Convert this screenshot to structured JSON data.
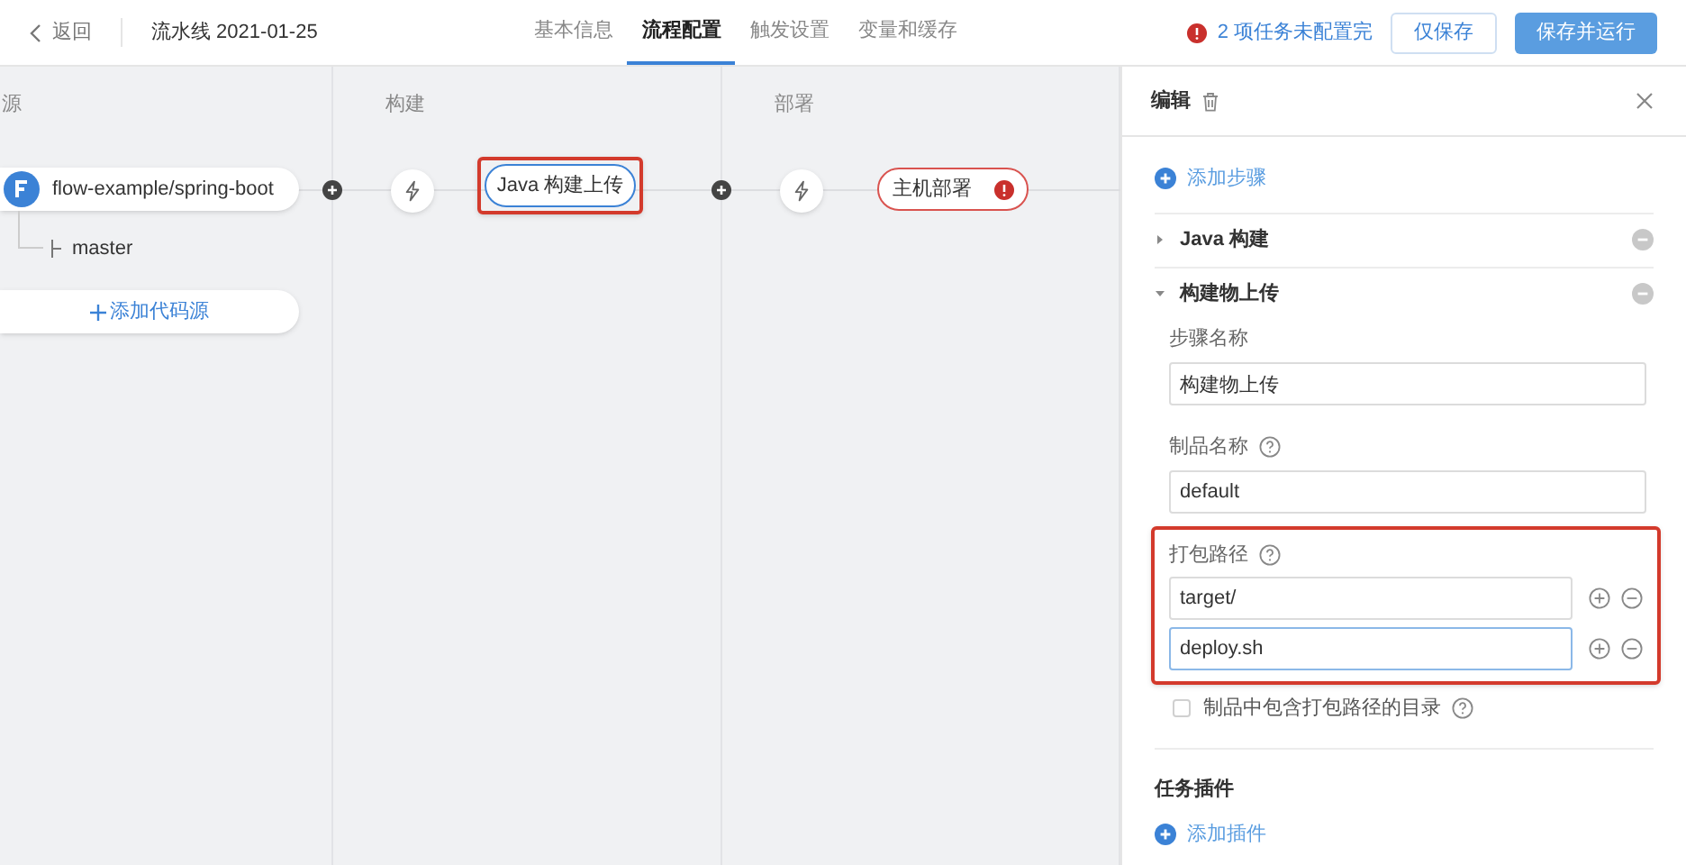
{
  "header": {
    "back": "返回",
    "title": "流水线 2021-01-25",
    "tabs": [
      {
        "label": "基本信息",
        "selected": false
      },
      {
        "label": "流程配置",
        "selected": true
      },
      {
        "label": "触发设置",
        "selected": false
      },
      {
        "label": "变量和缓存",
        "selected": false
      }
    ],
    "warning": "2 项任务未配置完",
    "buttons": [
      {
        "label": "仅保存",
        "kind": "secondary"
      },
      {
        "label": "保存并运行",
        "kind": "primary"
      }
    ]
  },
  "canvas": {
    "stages": [
      {
        "label": "源"
      },
      {
        "label": "构建"
      },
      {
        "label": "部署"
      }
    ],
    "source": {
      "repo": "flow-example/spring-boot",
      "branch": "master",
      "add_button": "添加代码源"
    },
    "tasks": [
      {
        "label": "Java 构建上传",
        "error": false,
        "highlighted": true
      },
      {
        "label": "主机部署",
        "error": true,
        "highlighted": false
      }
    ]
  },
  "panel": {
    "title": "编辑",
    "add_step": "添加步骤",
    "steps": [
      {
        "name": "Java 构建",
        "expanded": false
      },
      {
        "name": "构建物上传",
        "expanded": true
      }
    ],
    "step_name": {
      "label": "步骤名称",
      "value": "构建物上传"
    },
    "artifact_name": {
      "label": "制品名称",
      "value": "default"
    },
    "package_paths": {
      "label": "打包路径",
      "highlighted": true,
      "rows": [
        {
          "value": "target/",
          "focused": false
        },
        {
          "value": "deploy.sh",
          "focused": true
        }
      ]
    },
    "include_dir": {
      "label": "制品中包含打包路径的目录",
      "checked": false
    },
    "plugins_title": "任务插件",
    "add_plugin": "添加插件"
  }
}
